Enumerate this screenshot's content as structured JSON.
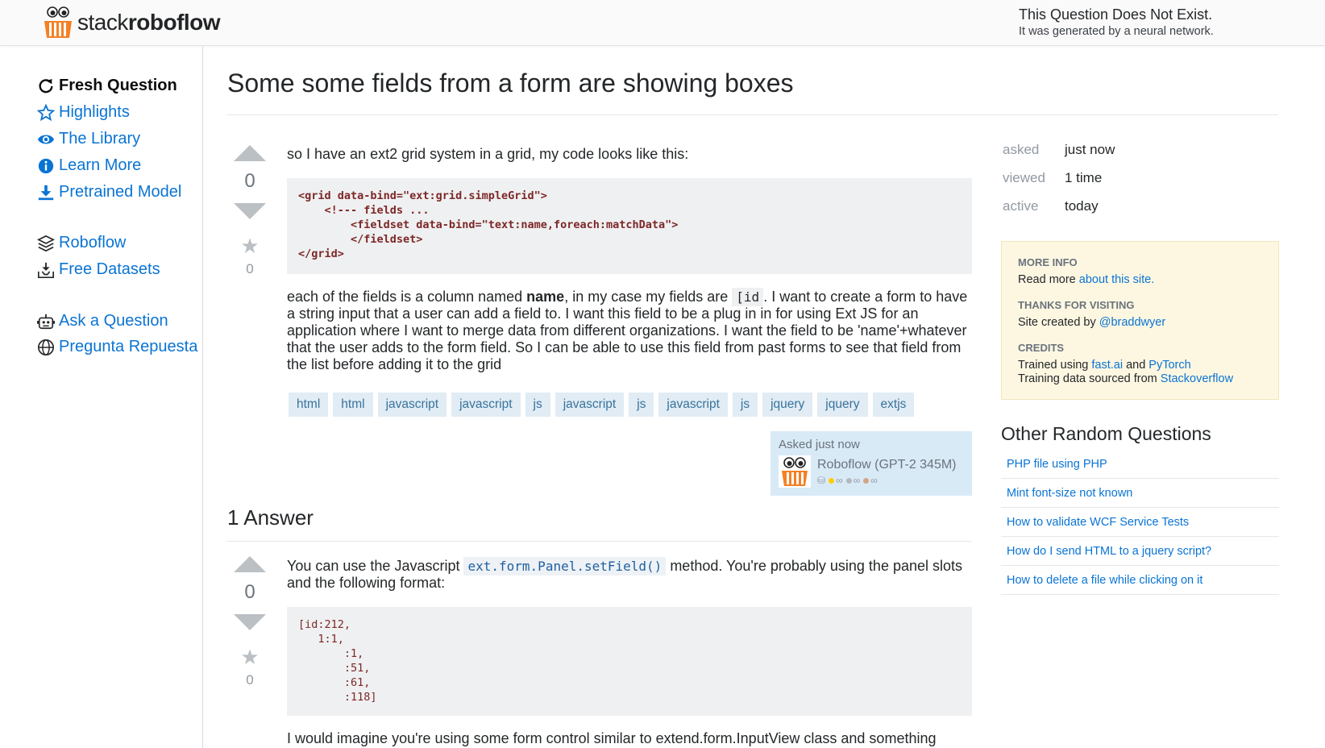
{
  "header": {
    "logo_light": "stack",
    "logo_bold": "roboflow",
    "notice_title": "This Question Does Not Exist.",
    "notice_sub": "It was generated by a neural network."
  },
  "nav": {
    "items": [
      {
        "label": "Fresh Question",
        "icon": "refresh-icon",
        "active": true
      },
      {
        "label": "Highlights",
        "icon": "star-outline-icon"
      },
      {
        "label": "The Library",
        "icon": "eye-icon"
      },
      {
        "label": "Learn More",
        "icon": "info-icon"
      },
      {
        "label": "Pretrained Model",
        "icon": "download-icon"
      },
      {
        "label": "Roboflow",
        "icon": "layers-icon"
      },
      {
        "label": "Free Datasets",
        "icon": "tray-download-icon"
      },
      {
        "label": "Ask a Question",
        "icon": "robot-icon"
      },
      {
        "label": "Pregunta Repuesta",
        "icon": "globe-icon"
      }
    ]
  },
  "question": {
    "title": "Some some fields from a form are showing boxes",
    "votes": "0",
    "favorites": "0",
    "intro": "so I have an ext2 grid system in a grid, my code looks like this:",
    "code_lines": [
      "<grid data-bind=\"ext:grid.simpleGrid\">",
      "    <!--- fields ...",
      "        <fieldset data-bind=\"text:name,foreach:matchData\">",
      "        </fieldset>",
      "</grid>"
    ],
    "body_pre": "each of the fields is a column named ",
    "body_bold": "name",
    "body_mid": ", in my case my fields are ",
    "body_code": "[id",
    "body_post": ". I want to create a form to have a string input that a user can add a field to. I want this field to be a plug in in for using Ext JS for an application where I want to merge data from different organizations. I want the field to be 'name'+whatever that the user adds to the form field. So I can be able to use this field from past forms to see that field from the list before adding it to the grid",
    "tags": [
      "html",
      "html",
      "javascript",
      "javascript",
      "js",
      "javascript",
      "js",
      "javascript",
      "js",
      "jquery",
      "jquery",
      "extjs"
    ],
    "owner": {
      "asked": "Asked just now",
      "name": "Roboflow (GPT-2 345M)",
      "badges": [
        "∞",
        "∞",
        "∞"
      ]
    }
  },
  "answers": {
    "title": "1 Answer",
    "items": [
      {
        "votes": "0",
        "favorites": "0",
        "text_pre": "You can use the Javascript ",
        "text_code": "ext.form.Panel.setField()",
        "text_post": " method. You're probably using the panel slots and the following format:",
        "code": "[id:212,\n   1:1,\n       :1,\n       :51,\n       :61,\n       :118]",
        "tail": "I would imagine you're using some form control similar to extend.form.InputView class and something"
      }
    ]
  },
  "stats": [
    {
      "k": "asked",
      "v": "just now"
    },
    {
      "k": "viewed",
      "v": "1 time"
    },
    {
      "k": "active",
      "v": "today"
    }
  ],
  "info": {
    "more_info_head": "MORE INFO",
    "more_info_pre": "Read more ",
    "more_info_link": "about this site.",
    "thanks_head": "THANKS FOR VISITING",
    "thanks_pre": "Site created by ",
    "thanks_link": "@braddwyer",
    "credits_head": "CREDITS",
    "credits_pre": "Trained using ",
    "credits_link1": "fast.ai",
    "credits_and": " and ",
    "credits_link2": "PyTorch",
    "credits2_pre": "Training data sourced from ",
    "credits2_link": "Stackoverflow"
  },
  "other": {
    "title": "Other Random Questions",
    "items": [
      "PHP file using PHP",
      "Mint font-size not known",
      "How to validate WCF Service Tests",
      "How do I send HTML to a jquery script?",
      "How to delete a file while clicking on it"
    ]
  },
  "colors": {
    "link": "#0a74d4",
    "tag_bg": "#e1ecf4",
    "tag_fg": "#39739d",
    "info_bg": "#fdf7e2",
    "owner_bg": "#d9eaf7"
  }
}
